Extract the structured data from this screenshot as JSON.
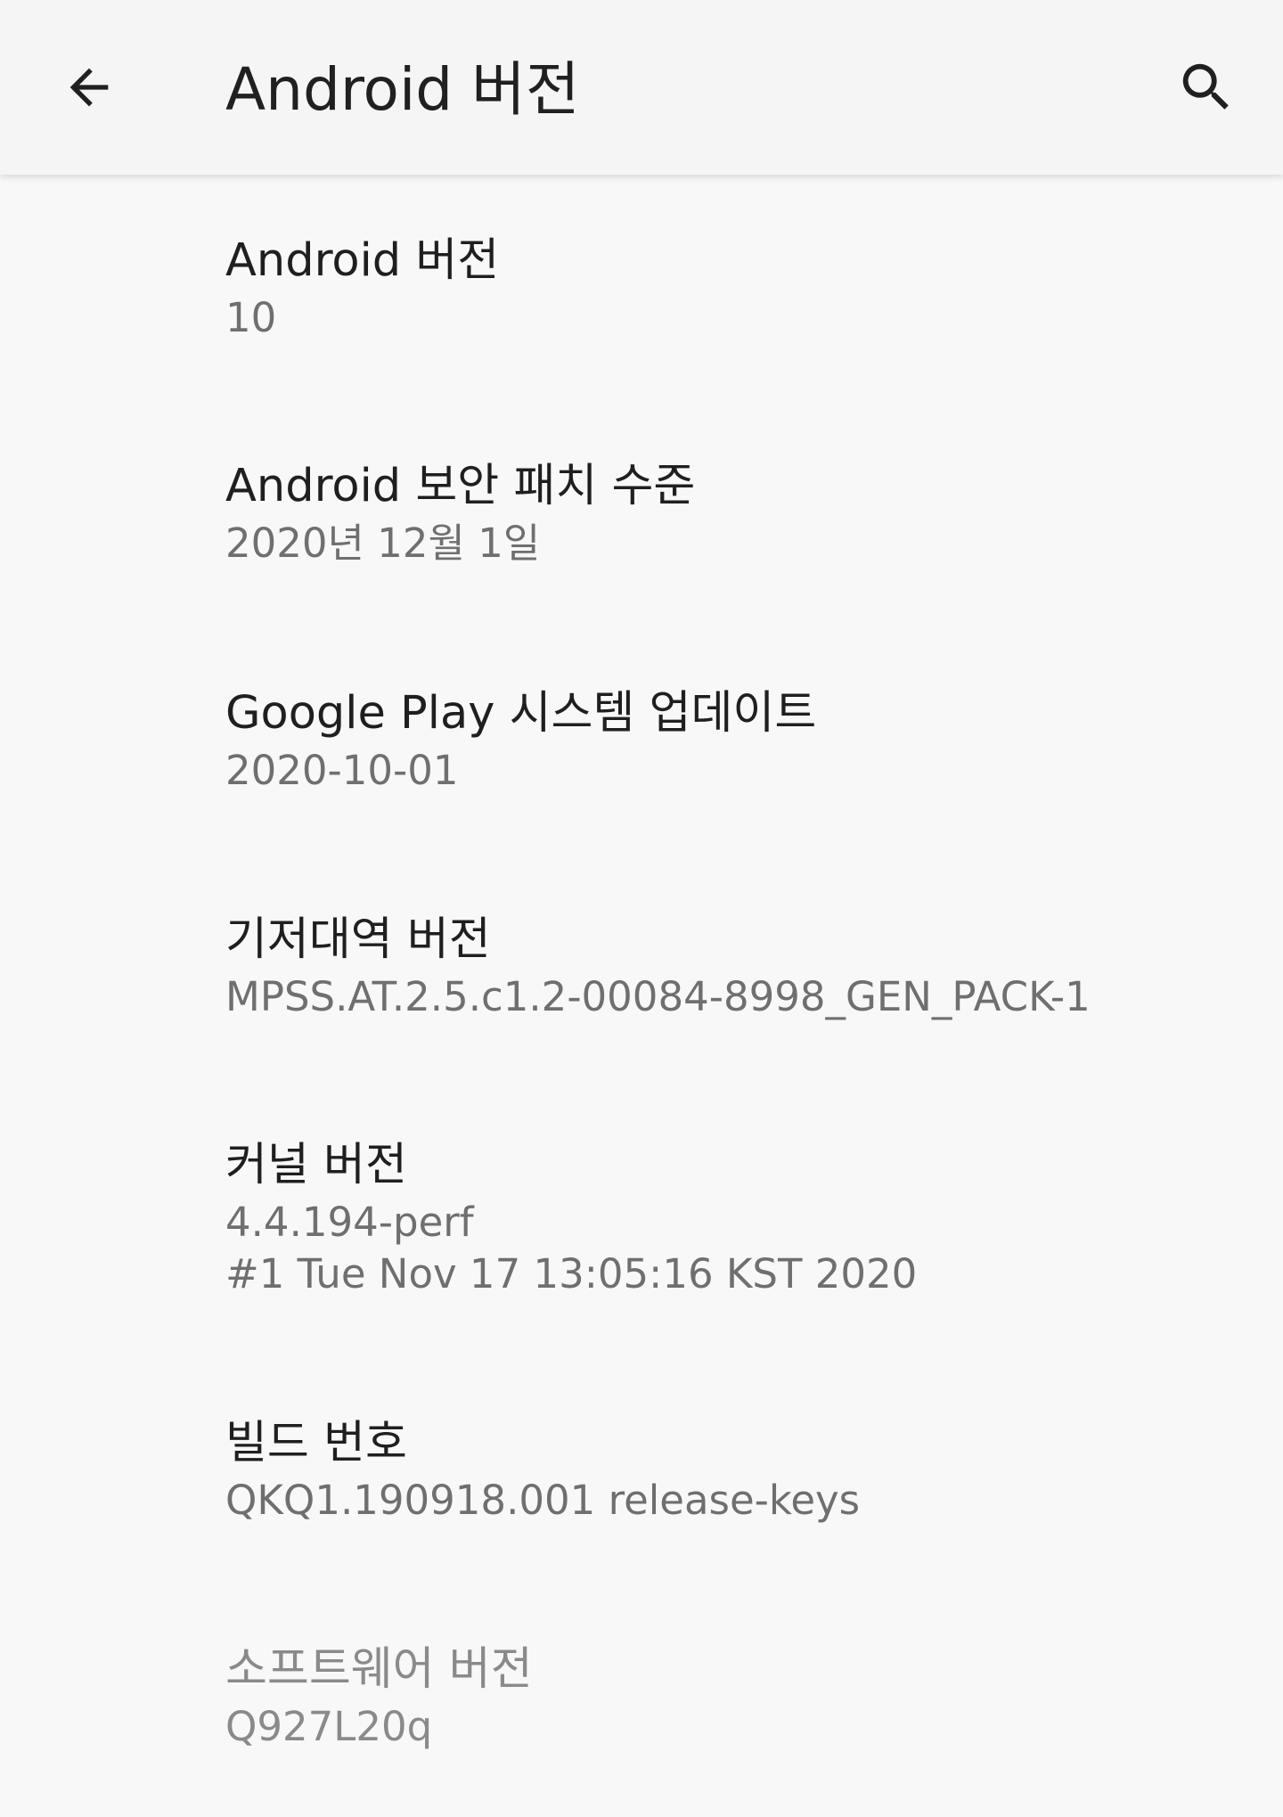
{
  "header": {
    "title": "Android 버전",
    "back_icon": "arrow-left-icon",
    "search_icon": "search-icon"
  },
  "items": [
    {
      "title": "Android 버전",
      "summary": "10"
    },
    {
      "title": "Android 보안 패치 수준",
      "summary": "2020년 12월 1일"
    },
    {
      "title": "Google Play 시스템 업데이트",
      "summary": "2020-10-01"
    },
    {
      "title": "기저대역 버전",
      "summary": "MPSS.AT.2.5.c1.2-00084-8998_GEN_PACK-1"
    },
    {
      "title": "커널 버전",
      "summary": "4.4.194-perf\n#1 Tue Nov 17 13:05:16 KST 2020"
    },
    {
      "title": "빌드 번호",
      "summary": "QKQ1.190918.001 release-keys"
    },
    {
      "title": "소프트웨어 버전",
      "summary": "Q927L20q"
    }
  ]
}
